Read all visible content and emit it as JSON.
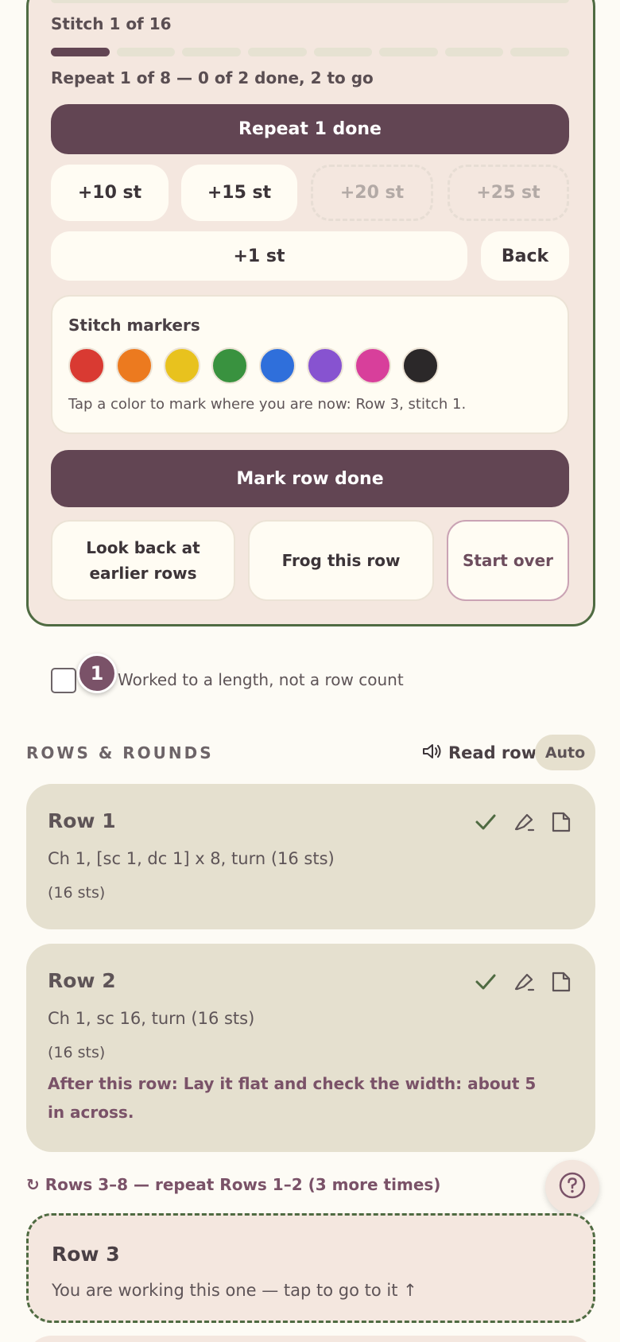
{
  "counter": {
    "stitch_label": "Stitch 1 of 16",
    "segments_total": 8,
    "segments_done": 1,
    "repeat_label": "Repeat 1 of 8 — 0 of 2 done, 2 to go",
    "repeat_done_button": "Repeat 1 done",
    "plus_buttons": [
      {
        "label": "+10 st",
        "enabled": true
      },
      {
        "label": "+15 st",
        "enabled": true
      },
      {
        "label": "+20 st",
        "enabled": false
      },
      {
        "label": "+25 st",
        "enabled": false
      }
    ],
    "plus_one_button": "+1 st",
    "back_button": "Back",
    "markers": {
      "title": "Stitch markers",
      "colors": [
        "#d93a32",
        "#ec7a1f",
        "#e8c21e",
        "#39923f",
        "#2f6fdb",
        "#8753d0",
        "#d83f9b",
        "#2b2829"
      ],
      "hint": "Tap a color to mark where you are now: Row 3, stitch 1."
    },
    "mark_row_done_button": "Mark row done",
    "look_back_button": "Look back at earlier rows",
    "frog_button": "Frog this row",
    "start_over_button": "Start over"
  },
  "length_option": {
    "checked": false,
    "step_badge": "1",
    "label": "Worked to a length, not a row count"
  },
  "section": {
    "title": "ROWS & ROUNDS",
    "read_row_label": "Read row",
    "auto_label": "Auto"
  },
  "rows": [
    {
      "title": "Row 1",
      "instruction": "Ch 1, [sc 1, dc 1] x 8, turn (16 sts)",
      "stitch_count": "(16 sts)",
      "note": ""
    },
    {
      "title": "Row 2",
      "instruction": "Ch 1, sc 16, turn (16 sts)",
      "stitch_count": "(16 sts)",
      "note": "After this row: Lay it flat and check the width: about 5 in across."
    }
  ],
  "repeat_note": "↻ Rows 3–8 — repeat Rows 1–2 (3 more times)",
  "current_row": {
    "title": "Row 3",
    "text": "You are working this one — tap to go to it ↑"
  },
  "colors": {
    "accent_dark": "#624553",
    "current_border": "#4f6b42",
    "note_text": "#7a5268"
  }
}
